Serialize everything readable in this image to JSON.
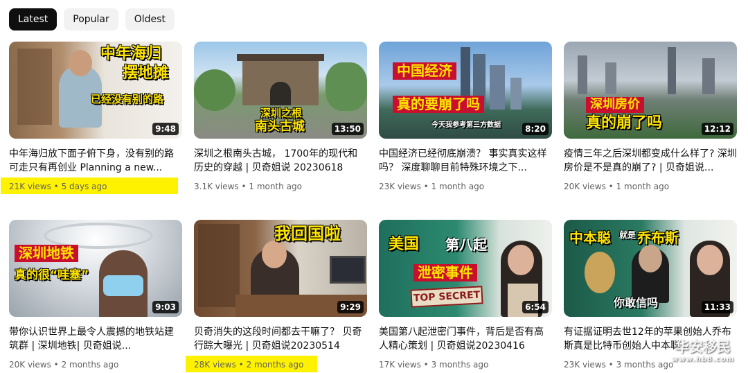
{
  "filters": [
    "Latest",
    "Popular",
    "Oldest"
  ],
  "videos": [
    {
      "title": "中年海归放下面子俯下身，没有别的路可走只有再创业 Planning a new...",
      "views": "21K views",
      "age": "5 days ago",
      "duration": "9:48",
      "thumb_text": [
        "中年海归",
        "摆地摊",
        "已经没有别的路"
      ]
    },
    {
      "title": "深圳之根南头古城， 1700年的现代和历史的穿越 | 贝奇姐说 20230618",
      "views": "3.1K views",
      "age": "1 month ago",
      "duration": "13:50",
      "thumb_text": [
        "深圳之根",
        "南头古城"
      ]
    },
    {
      "title": "中国经济已经彻底崩溃？ 事实真实这样吗？ 深度聊聊目前特殊环境之下...",
      "views": "23K views",
      "age": "1 month ago",
      "duration": "8:20",
      "thumb_text": [
        "中国经济",
        "真的要崩了吗",
        "今天我参考第三方数据"
      ]
    },
    {
      "title": "疫情三年之后深圳都变成什么样了? 深圳房价是不是真的崩了? | 贝奇姐说...",
      "views": "20K views",
      "age": "1 month ago",
      "duration": "12:12",
      "thumb_text": [
        "深圳房价",
        "真的崩了吗"
      ]
    },
    {
      "title": "带你认识世界上最令人震撼的地铁站建筑群 | 深圳地铁| 贝奇姐说...",
      "views": "20K views",
      "age": "2 months ago",
      "duration": "9:03",
      "thumb_text": [
        "深圳地铁",
        "真的很“哇塞”"
      ]
    },
    {
      "title": "贝奇消失的这段时间都去干嘛了？ 贝奇行踪大曝光 | 贝奇姐说20230514",
      "views": "28K views",
      "age": "2 months ago",
      "duration": "9:29",
      "thumb_text": [
        "我回国啦"
      ]
    },
    {
      "title": "美国第八起泄密门事件，背后是否有高人精心策划 | 贝奇姐说20230416",
      "views": "17K views",
      "age": "3 months ago",
      "duration": "6:54",
      "thumb_text": [
        "美国",
        "第八起",
        "泄密事件",
        "TOP SECRET"
      ]
    },
    {
      "title": "有证据证明去世12年的苹果创始人乔布斯真是比特币创始人中本聪...",
      "views": "23K views",
      "age": "3 months ago",
      "duration": "11:33",
      "thumb_text": [
        "中本聪",
        "就是",
        "乔布斯",
        "你敢信吗"
      ]
    }
  ],
  "separator": "•",
  "watermark": [
    "华安移民",
    "www.hb8.com"
  ],
  "colors": {
    "highlight": "#fff200",
    "caption_yellow": "#ffe500",
    "chip_active": "#0f0f0f"
  }
}
